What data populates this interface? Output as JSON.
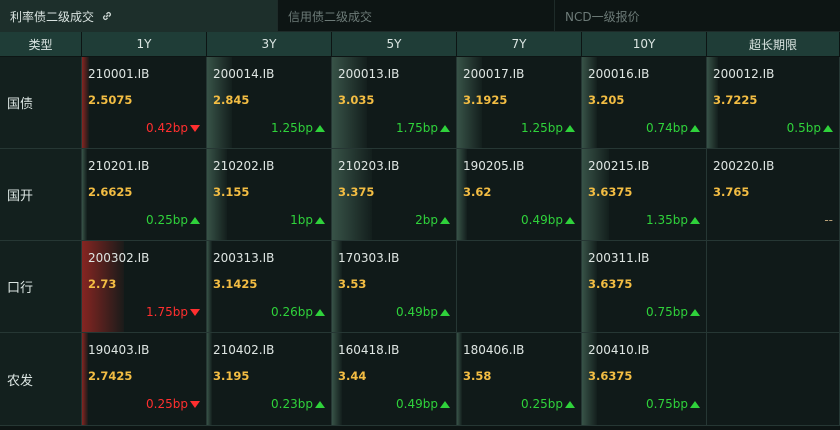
{
  "tabs": [
    {
      "label": "利率债二级成交",
      "active": true
    },
    {
      "label": "信用债二级成交",
      "active": false
    },
    {
      "label": "NCD一级报价",
      "active": false
    }
  ],
  "headers": [
    "类型",
    "1Y",
    "3Y",
    "5Y",
    "7Y",
    "10Y",
    "超长期限"
  ],
  "colors": {
    "up": "#2fd23b",
    "down": "#ff2f2f",
    "rate": "#f3bd43",
    "header_bg": "#1f3d37"
  },
  "rows": [
    {
      "label": "国债",
      "cells": [
        {
          "code": "210001.IB",
          "rate": "2.5075",
          "change": "0.42bp",
          "dir": "down",
          "level": 0.06
        },
        {
          "code": "200014.IB",
          "rate": "2.845",
          "change": "1.25bp",
          "dir": "up",
          "level": 0.2
        },
        {
          "code": "200013.IB",
          "rate": "3.035",
          "change": "1.75bp",
          "dir": "up",
          "level": 0.28
        },
        {
          "code": "200017.IB",
          "rate": "3.1925",
          "change": "1.25bp",
          "dir": "up",
          "level": 0.2
        },
        {
          "code": "200016.IB",
          "rate": "3.205",
          "change": "0.74bp",
          "dir": "up",
          "level": 0.12
        },
        {
          "code": "200012.IB",
          "rate": "3.7225",
          "change": "0.5bp",
          "dir": "up",
          "level": 0.08
        }
      ]
    },
    {
      "label": "国开",
      "cells": [
        {
          "code": "210201.IB",
          "rate": "2.6625",
          "change": "0.25bp",
          "dir": "up",
          "level": 0.04
        },
        {
          "code": "210202.IB",
          "rate": "3.155",
          "change": "1bp",
          "dir": "up",
          "level": 0.16
        },
        {
          "code": "210203.IB",
          "rate": "3.375",
          "change": "2bp",
          "dir": "up",
          "level": 0.32
        },
        {
          "code": "190205.IB",
          "rate": "3.62",
          "change": "0.49bp",
          "dir": "up",
          "level": 0.08
        },
        {
          "code": "200215.IB",
          "rate": "3.6375",
          "change": "1.35bp",
          "dir": "up",
          "level": 0.22
        },
        {
          "code": "200220.IB",
          "rate": "3.765",
          "change": "--",
          "dir": "none",
          "level": 0
        }
      ]
    },
    {
      "label": "口行",
      "cells": [
        {
          "code": "200302.IB",
          "rate": "2.73",
          "change": "1.75bp",
          "dir": "down",
          "level": 0.34
        },
        {
          "code": "200313.IB",
          "rate": "3.1425",
          "change": "0.26bp",
          "dir": "up",
          "level": 0.04
        },
        {
          "code": "170303.IB",
          "rate": "3.53",
          "change": "0.49bp",
          "dir": "up",
          "level": 0.08
        },
        {
          "code": "",
          "rate": "",
          "change": "",
          "dir": "empty",
          "level": 0
        },
        {
          "code": "200311.IB",
          "rate": "3.6375",
          "change": "0.75bp",
          "dir": "up",
          "level": 0.12
        },
        {
          "code": "",
          "rate": "",
          "change": "",
          "dir": "empty",
          "level": 0
        }
      ]
    },
    {
      "label": "农发",
      "cells": [
        {
          "code": "190403.IB",
          "rate": "2.7425",
          "change": "0.25bp",
          "dir": "down",
          "level": 0.05
        },
        {
          "code": "210402.IB",
          "rate": "3.195",
          "change": "0.23bp",
          "dir": "up",
          "level": 0.04
        },
        {
          "code": "160418.IB",
          "rate": "3.44",
          "change": "0.49bp",
          "dir": "up",
          "level": 0.08
        },
        {
          "code": "180406.IB",
          "rate": "3.58",
          "change": "0.25bp",
          "dir": "up",
          "level": 0.04
        },
        {
          "code": "200410.IB",
          "rate": "3.6375",
          "change": "0.75bp",
          "dir": "up",
          "level": 0.12
        },
        {
          "code": "",
          "rate": "",
          "change": "",
          "dir": "empty",
          "level": 0
        }
      ]
    }
  ]
}
